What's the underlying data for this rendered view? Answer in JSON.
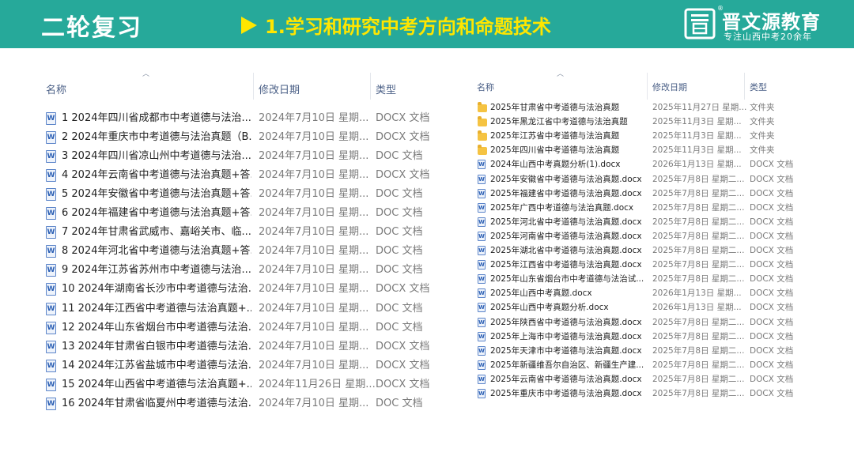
{
  "banner": {
    "title": "二轮复习",
    "subtitle": "1.学习和研究中考方向和命题技术",
    "brand_name": "晋文源教育",
    "brand_reg": "®",
    "brand_tagline": "专注山西中考20余年",
    "colors": {
      "background": "#26a99a",
      "subtitle": "#ffe600",
      "title": "#ffffff"
    }
  },
  "left_explorer": {
    "columns": {
      "name": "名称",
      "date": "修改日期",
      "type": "类型"
    },
    "files": [
      {
        "icon": "word-doc-icon",
        "name": "1 2024年四川省成都市中考道德与法治...",
        "date": "2024年7月10日 星期...",
        "type": "DOCX 文档"
      },
      {
        "icon": "word-doc-icon",
        "name": "2 2024年重庆市中考道德与法治真题（B...",
        "date": "2024年7月10日 星期...",
        "type": "DOCX 文档"
      },
      {
        "icon": "word-doc-icon",
        "name": "3 2024年四川省凉山州中考道德与法治...",
        "date": "2024年7月10日 星期...",
        "type": "DOC 文档"
      },
      {
        "icon": "word-doc-icon",
        "name": "4 2024年云南省中考道德与法治真题+答...",
        "date": "2024年7月10日 星期...",
        "type": "DOCX 文档"
      },
      {
        "icon": "word-doc-icon",
        "name": "5 2024年安徽省中考道德与法治真题+答...",
        "date": "2024年7月10日 星期...",
        "type": "DOC 文档"
      },
      {
        "icon": "word-doc-icon",
        "name": "6 2024年福建省中考道德与法治真题+答...",
        "date": "2024年7月10日 星期...",
        "type": "DOC 文档"
      },
      {
        "icon": "word-doc-icon",
        "name": "7 2024年甘肃省武威市、嘉峪关市、临...",
        "date": "2024年7月10日 星期...",
        "type": "DOC 文档"
      },
      {
        "icon": "word-doc-icon",
        "name": "8 2024年河北省中考道德与法治真题+答...",
        "date": "2024年7月10日 星期...",
        "type": "DOC 文档"
      },
      {
        "icon": "word-doc-icon",
        "name": "9 2024年江苏省苏州市中考道德与法治...",
        "date": "2024年7月10日 星期...",
        "type": "DOC 文档"
      },
      {
        "icon": "word-doc-icon",
        "name": "10 2024年湖南省长沙市中考道德与法治...",
        "date": "2024年7月10日 星期...",
        "type": "DOCX 文档"
      },
      {
        "icon": "word-doc-icon",
        "name": "11 2024年江西省中考道德与法治真题+...",
        "date": "2024年7月10日 星期...",
        "type": "DOC 文档"
      },
      {
        "icon": "word-doc-icon",
        "name": "12 2024年山东省烟台市中考道德与法治...",
        "date": "2024年7月10日 星期...",
        "type": "DOC 文档"
      },
      {
        "icon": "word-doc-icon",
        "name": "13 2024年甘肃省白银市中考道德与法治...",
        "date": "2024年7月10日 星期...",
        "type": "DOCX 文档"
      },
      {
        "icon": "word-doc-icon",
        "name": "14 2024年江苏省盐城市中考道德与法治...",
        "date": "2024年7月10日 星期...",
        "type": "DOCX 文档"
      },
      {
        "icon": "word-doc-icon",
        "name": "15 2024年山西省中考道德与法治真题+...",
        "date": "2024年11月26日 星期...",
        "type": "DOCX 文档"
      },
      {
        "icon": "word-doc-icon",
        "name": "16 2024年甘肃省临夏州中考道德与法治...",
        "date": "2024年7月10日 星期...",
        "type": "DOC 文档"
      }
    ]
  },
  "right_explorer": {
    "columns": {
      "name": "名称",
      "date": "修改日期",
      "type": "类型"
    },
    "files": [
      {
        "icon": "folder-icon",
        "name": "2025年甘肃省中考道德与法治真题",
        "date": "2025年11月27日 星期...",
        "type": "文件夹"
      },
      {
        "icon": "folder-icon",
        "name": "2025年黑龙江省中考道德与法治真题",
        "date": "2025年11月3日 星期...",
        "type": "文件夹"
      },
      {
        "icon": "folder-icon",
        "name": "2025年江苏省中考道德与法治真题",
        "date": "2025年11月3日 星期...",
        "type": "文件夹"
      },
      {
        "icon": "folder-icon",
        "name": "2025年四川省中考道德与法治真题",
        "date": "2025年11月3日 星期...",
        "type": "文件夹"
      },
      {
        "icon": "word-doc-icon",
        "name": "2024年山西中考真题分析(1).docx",
        "date": "2026年1月13日 星期...",
        "type": "DOCX 文档"
      },
      {
        "icon": "word-doc-icon",
        "name": "2025年安徽省中考道德与法治真题.docx",
        "date": "2025年7月8日 星期二...",
        "type": "DOCX 文档"
      },
      {
        "icon": "word-doc-icon",
        "name": "2025年福建省中考道德与法治真题.docx",
        "date": "2025年7月8日 星期二...",
        "type": "DOCX 文档"
      },
      {
        "icon": "word-doc-icon",
        "name": "2025年广西中考道德与法治真题.docx",
        "date": "2025年7月8日 星期二...",
        "type": "DOCX 文档"
      },
      {
        "icon": "word-doc-icon",
        "name": "2025年河北省中考道德与法治真题.docx",
        "date": "2025年7月8日 星期二...",
        "type": "DOCX 文档"
      },
      {
        "icon": "word-doc-icon",
        "name": "2025年河南省中考道德与法治真题.docx",
        "date": "2025年7月8日 星期二...",
        "type": "DOCX 文档"
      },
      {
        "icon": "word-doc-icon",
        "name": "2025年湖北省中考道德与法治真题.docx",
        "date": "2025年7月8日 星期二...",
        "type": "DOCX 文档"
      },
      {
        "icon": "word-doc-icon",
        "name": "2025年江西省中考道德与法治真题.docx",
        "date": "2025年7月8日 星期二...",
        "type": "DOCX 文档"
      },
      {
        "icon": "word-doc-icon",
        "name": "2025年山东省烟台市中考道德与法治试...",
        "date": "2025年7月8日 星期二...",
        "type": "DOCX 文档"
      },
      {
        "icon": "word-doc-icon",
        "name": "2025年山西中考真题.docx",
        "date": "2026年1月13日 星期...",
        "type": "DOCX 文档"
      },
      {
        "icon": "word-doc-icon",
        "name": "2025年山西中考真题分析.docx",
        "date": "2026年1月13日 星期...",
        "type": "DOCX 文档"
      },
      {
        "icon": "word-doc-icon",
        "name": "2025年陕西省中考道德与法治真题.docx",
        "date": "2025年7月8日 星期二...",
        "type": "DOCX 文档"
      },
      {
        "icon": "word-doc-icon",
        "name": "2025年上海市中考道德与法治真题.docx",
        "date": "2025年7月8日 星期二...",
        "type": "DOCX 文档"
      },
      {
        "icon": "word-doc-icon",
        "name": "2025年天津市中考道德与法治真题.docx",
        "date": "2025年7月8日 星期二...",
        "type": "DOCX 文档"
      },
      {
        "icon": "word-doc-icon",
        "name": "2025年新疆维吾尔自治区、新疆生产建...",
        "date": "2025年7月8日 星期二...",
        "type": "DOCX 文档"
      },
      {
        "icon": "word-doc-icon",
        "name": "2025年云南省中考道德与法治真题.docx",
        "date": "2025年7月8日 星期二...",
        "type": "DOCX 文档"
      },
      {
        "icon": "word-doc-icon",
        "name": "2025年重庆市中考道德与法治真题.docx",
        "date": "2025年7月8日 星期二...",
        "type": "DOCX 文档"
      }
    ]
  }
}
